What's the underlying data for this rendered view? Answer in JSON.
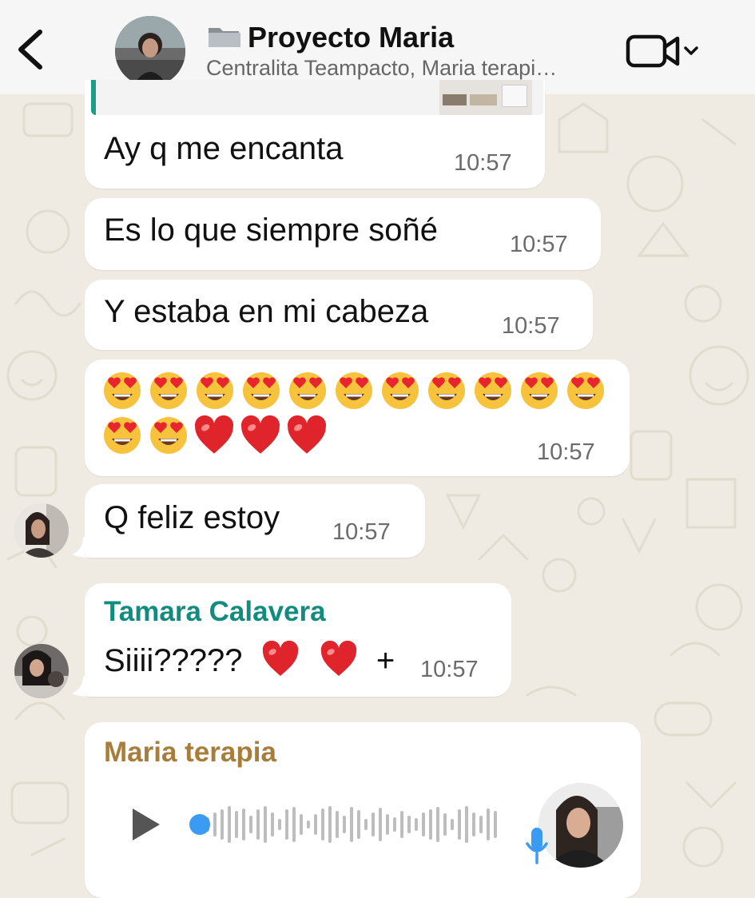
{
  "header": {
    "title": "Proyecto Maria",
    "title_icon": "folder-icon",
    "subtitle": "Centralita Teampacto, Maria terapi…",
    "back_icon": "chevron-left-icon",
    "video_icon": "video-camera-icon",
    "video_menu_icon": "chevron-down-icon"
  },
  "messages": [
    {
      "text": "Ay q me encanta",
      "time": "10:57"
    },
    {
      "text": "Es lo que siempre soñé",
      "time": "10:57"
    },
    {
      "text": "Y estaba en mi cabeza",
      "time": "10:57"
    },
    {
      "emoji_counts": {
        "heart_eyes_row1": 11,
        "heart_eyes_row2": 2,
        "red_hearts": 3
      },
      "time": "10:57"
    },
    {
      "text": "Q feliz estoy",
      "time": "10:57"
    },
    {
      "sender": "Tamara Calavera",
      "text": "Siiii?????",
      "suffix": "+",
      "time": "10:57"
    },
    {
      "sender": "Maria terapia",
      "type": "voice-note"
    }
  ],
  "colors": {
    "background": "#efeae2",
    "bubble": "#ffffff",
    "sender_tamara": "#128c7e",
    "sender_maria": "#a87c3a",
    "mic": "#3a9bf0",
    "waveform": "#bdbdbd",
    "playhead": "#3a9bf0"
  }
}
